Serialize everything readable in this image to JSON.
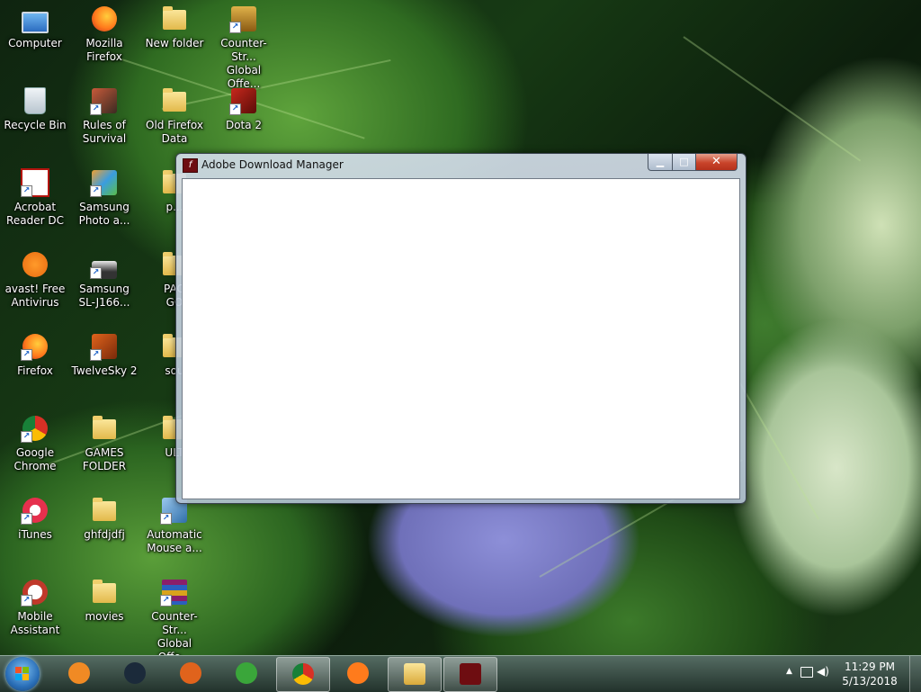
{
  "desktop": {
    "icons": [
      {
        "label": "Computer",
        "icon": "computer-icon"
      },
      {
        "label": "Mozilla\nFirefox",
        "icon": "firefox-icon"
      },
      {
        "label": "New folder",
        "icon": "folder-icon"
      },
      {
        "label": "Counter-Str...\nGlobal Offe...",
        "icon": "csgo-icon"
      },
      {
        "label": "Recycle Bin",
        "icon": "recycle-bin-icon"
      },
      {
        "label": "Rules of\nSurvival",
        "icon": "rules-of-survival-icon"
      },
      {
        "label": "Old Firefox\nData",
        "icon": "folder-icon"
      },
      {
        "label": "Dota 2",
        "icon": "dota2-icon"
      },
      {
        "label": "Acrobat\nReader DC",
        "icon": "acrobat-icon"
      },
      {
        "label": "Samsung\nPhoto a...",
        "icon": "samsung-photo-icon"
      },
      {
        "label": "p...",
        "icon": "folder-icon"
      },
      {
        "label": "avast! Free\nAntivirus",
        "icon": "avast-icon"
      },
      {
        "label": "Samsung\nSL-J166...",
        "icon": "printer-icon"
      },
      {
        "label": "PAO\nGO",
        "icon": "folder-icon"
      },
      {
        "label": "Firefox",
        "icon": "firefox-icon"
      },
      {
        "label": "TwelveSky 2",
        "icon": "twelvesky-icon"
      },
      {
        "label": "sou",
        "icon": "folder-icon"
      },
      {
        "label": "Google\nChrome",
        "icon": "chrome-icon"
      },
      {
        "label": "GAMES\nFOLDER",
        "icon": "folder-icon"
      },
      {
        "label": "ULT",
        "icon": "folder-icon"
      },
      {
        "label": "iTunes",
        "icon": "itunes-icon"
      },
      {
        "label": "ghfdjdfj",
        "icon": "folder-icon"
      },
      {
        "label": "Automatic\nMouse a...",
        "icon": "automatic-mouse-icon"
      },
      {
        "label": "Mobile\nAssistant",
        "icon": "mobile-assistant-icon"
      },
      {
        "label": "movies",
        "icon": "folder-icon"
      },
      {
        "label": "Counter-Str...\nGlobal Offe...",
        "icon": "winrar-icon"
      }
    ]
  },
  "window": {
    "title": "Adobe Download Manager",
    "icon": "adobe-flash-icon",
    "buttons": {
      "minimize": "▁",
      "maximize": "□",
      "close": "✕"
    }
  },
  "taskbar": {
    "pinned": [
      {
        "name": "media-player",
        "icon": "media-player-icon",
        "color": "#f08a24"
      },
      {
        "name": "steam",
        "icon": "steam-icon",
        "color": "#1b2a3a"
      },
      {
        "name": "twelvesky",
        "icon": "twelvesky-icon",
        "color": "#e0631c"
      },
      {
        "name": "installer",
        "icon": "install-arrow-icon",
        "color": "#3aa63a"
      },
      {
        "name": "chrome",
        "icon": "chrome-icon",
        "color": "#d93025"
      },
      {
        "name": "firefox",
        "icon": "firefox-icon",
        "color": "#ff7b1c"
      },
      {
        "name": "explorer",
        "icon": "folder-icon",
        "color": "#e8c456"
      },
      {
        "name": "adobe-download-manager",
        "icon": "adobe-flash-icon",
        "color": "#6e0d11"
      }
    ],
    "clock": {
      "time": "11:29 PM",
      "date": "5/13/2018"
    },
    "tray_icons": [
      "show-hidden-arrow-icon",
      "network-icon",
      "volume-icon"
    ]
  },
  "colors": {
    "accent": "#2a6fb8",
    "close_button": "#c9442a"
  }
}
